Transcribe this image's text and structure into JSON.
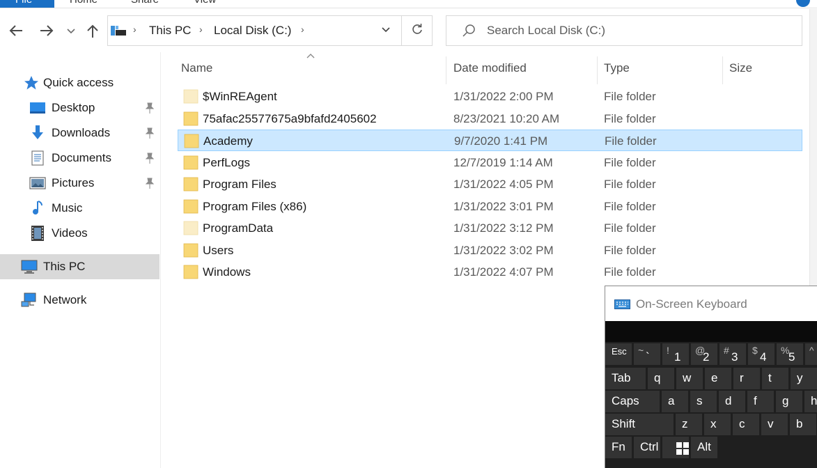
{
  "ribbon": {
    "tabs": [
      "File",
      "Home",
      "Share",
      "View"
    ]
  },
  "nav": {
    "back_icon": "arrow-left-icon",
    "forward_icon": "arrow-right-icon",
    "recent_icon": "chevron-down-icon",
    "up_icon": "arrow-up-icon"
  },
  "address": {
    "crumbs": [
      "This PC",
      "Local Disk (C:)"
    ],
    "separator": "›"
  },
  "search": {
    "placeholder": "Search Local Disk (C:)"
  },
  "navpane": {
    "items": [
      {
        "label": "Quick access",
        "icon": "star-icon"
      },
      {
        "label": "Desktop",
        "icon": "desktop-icon",
        "pinned": true
      },
      {
        "label": "Downloads",
        "icon": "download-arrow-icon",
        "pinned": true
      },
      {
        "label": "Documents",
        "icon": "document-icon",
        "pinned": true
      },
      {
        "label": "Pictures",
        "icon": "pictures-icon",
        "pinned": true
      },
      {
        "label": "Music",
        "icon": "music-note-icon"
      },
      {
        "label": "Videos",
        "icon": "film-icon"
      },
      {
        "label": "This PC",
        "icon": "computer-icon",
        "selected": true
      },
      {
        "label": "Network",
        "icon": "network-icon"
      }
    ]
  },
  "filelist": {
    "columns": [
      "Name",
      "Date modified",
      "Type",
      "Size"
    ],
    "rows": [
      {
        "name": "$WinREAgent",
        "date": "1/31/2022 2:00 PM",
        "type": "File folder",
        "faded": true
      },
      {
        "name": "75afac25577675a9bfafd2405602",
        "date": "8/23/2021 10:20 AM",
        "type": "File folder"
      },
      {
        "name": "Academy",
        "date": "9/7/2020 1:41 PM",
        "type": "File folder",
        "selected": true
      },
      {
        "name": "PerfLogs",
        "date": "12/7/2019 1:14 AM",
        "type": "File folder"
      },
      {
        "name": "Program Files",
        "date": "1/31/2022 4:05 PM",
        "type": "File folder"
      },
      {
        "name": "Program Files (x86)",
        "date": "1/31/2022 3:01 PM",
        "type": "File folder"
      },
      {
        "name": "ProgramData",
        "date": "1/31/2022 3:12 PM",
        "type": "File folder",
        "faded": true
      },
      {
        "name": "Users",
        "date": "1/31/2022 3:02 PM",
        "type": "File folder"
      },
      {
        "name": "Windows",
        "date": "1/31/2022 4:07 PM",
        "type": "File folder"
      }
    ]
  },
  "osk": {
    "title": "On-Screen Keyboard",
    "rows": [
      [
        {
          "label": "Esc",
          "small": true
        },
        {
          "shift": "~",
          "main": "`"
        },
        {
          "shift": "!",
          "main": "1"
        },
        {
          "shift": "@",
          "main": "2"
        },
        {
          "shift": "#",
          "main": "3"
        },
        {
          "shift": "$",
          "main": "4"
        },
        {
          "shift": "%",
          "main": "5"
        },
        {
          "shift": "^",
          "main": ""
        }
      ],
      [
        {
          "label": "Tab"
        },
        {
          "label": "q"
        },
        {
          "label": "w"
        },
        {
          "label": "e"
        },
        {
          "label": "r"
        },
        {
          "label": "t"
        },
        {
          "label": "y"
        }
      ],
      [
        {
          "label": "Caps"
        },
        {
          "label": "a"
        },
        {
          "label": "s"
        },
        {
          "label": "d"
        },
        {
          "label": "f"
        },
        {
          "label": "g"
        },
        {
          "label": "h"
        }
      ],
      [
        {
          "label": "Shift"
        },
        {
          "label": "z"
        },
        {
          "label": "x"
        },
        {
          "label": "c"
        },
        {
          "label": "v"
        },
        {
          "label": "b"
        }
      ],
      [
        {
          "label": "Fn"
        },
        {
          "label": "Ctrl"
        },
        {
          "label": "",
          "icon": "windows-logo-icon"
        },
        {
          "label": "Alt"
        }
      ]
    ]
  },
  "colors": {
    "accent": "#1a6fc4",
    "folder": "#f8d775",
    "folder_faded": "#faedc7",
    "selection": "#cce8ff",
    "selection_border": "#99d1ff",
    "nav_selected": "#d9d9d9",
    "osk_bg": "#1f1f1f",
    "osk_key": "#333333"
  }
}
